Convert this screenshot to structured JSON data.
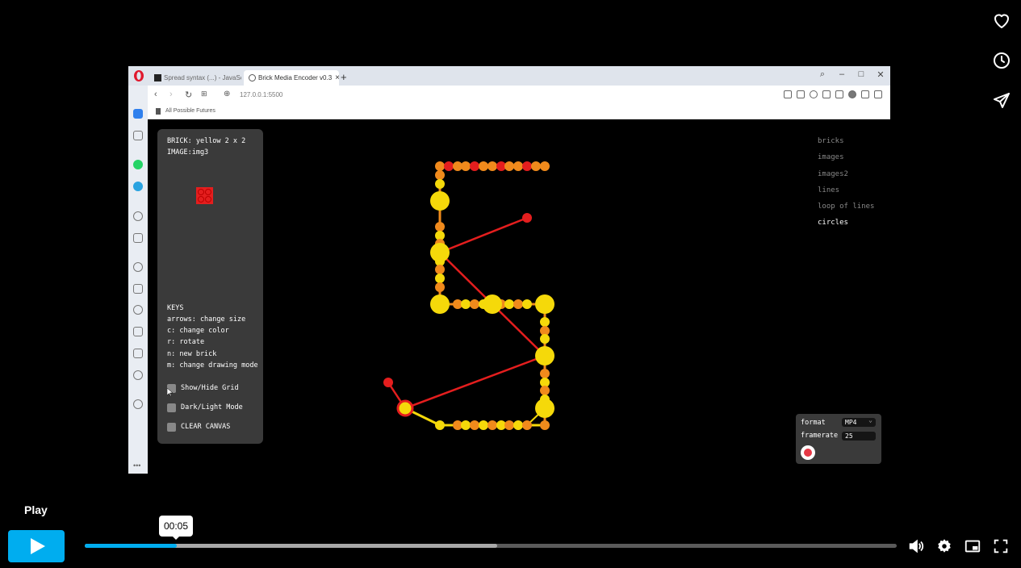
{
  "side_actions": [
    {
      "name": "like",
      "icon": "heart-icon"
    },
    {
      "name": "watch-later",
      "icon": "clock-icon"
    },
    {
      "name": "share",
      "icon": "send-icon"
    }
  ],
  "browser": {
    "tabs": [
      {
        "title": "Spread syntax (...) - JavaScript",
        "active": false
      },
      {
        "title": "Brick Media Encoder v0.3",
        "active": true
      }
    ],
    "url": "127.0.0.1:5500",
    "bookmark": "All Possible Futures"
  },
  "app": {
    "brick_label": "BRICK: yellow 2 x 2",
    "image_label": "IMAGE:img3",
    "keys": {
      "heading": "KEYS",
      "lines": [
        "arrows: change size",
        "c: change color",
        "r: rotate",
        "n: new brick",
        "m: change drawing mode"
      ]
    },
    "checkboxes": [
      {
        "label": "Show/Hide Grid"
      },
      {
        "label": "Dark/Light Mode"
      },
      {
        "label": "CLEAR CANVAS"
      }
    ],
    "menu": [
      {
        "label": "bricks",
        "active": false
      },
      {
        "label": "images",
        "active": false
      },
      {
        "label": "images2",
        "active": false
      },
      {
        "label": "lines",
        "active": false
      },
      {
        "label": "loop of lines",
        "active": false
      },
      {
        "label": "circles",
        "active": true
      }
    ],
    "recorder": {
      "format_label": "format",
      "format_value": "MP4",
      "framerate_label": "framerate",
      "framerate_value": "25"
    },
    "colors": {
      "yellow": "#f5d90a",
      "orange": "#f08a1c",
      "red": "#e41e1e"
    }
  },
  "player": {
    "play_label": "Play",
    "current_time": "00:05",
    "progress_fraction": 0.113,
    "buffered_fraction": 0.508,
    "accent": "#00adef"
  }
}
